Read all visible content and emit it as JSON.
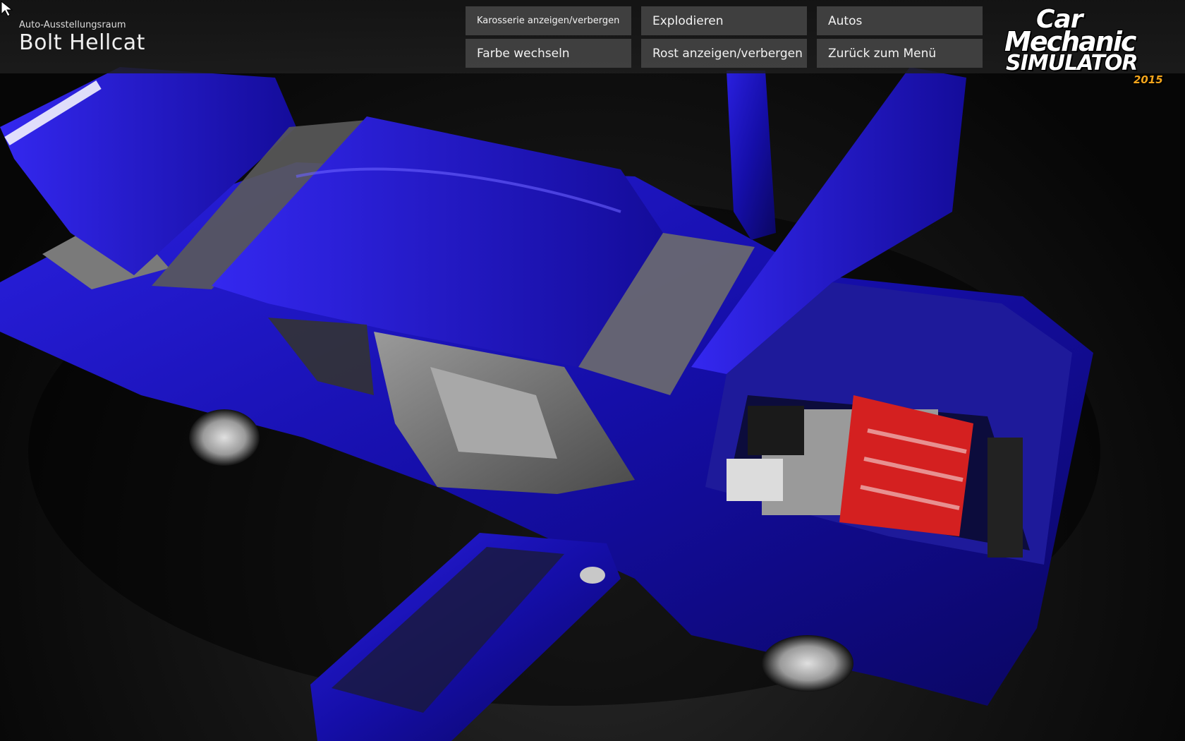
{
  "header": {
    "subtitle": "Auto-Ausstellungsraum",
    "car_name": "Bolt Hellcat"
  },
  "menu": {
    "toggle_body": "Karosserie anzeigen/verbergen",
    "explode": "Explodieren",
    "cars": "Autos",
    "change_color": "Farbe wechseln",
    "toggle_rust": "Rost anzeigen/verbergen",
    "back_to_menu": "Zurück zum Menü"
  },
  "logo": {
    "line1": "Car",
    "line2": "Mechanic",
    "line3": "SIMULATOR",
    "year": "2015"
  },
  "colors": {
    "car_paint": "#1a14c8",
    "engine_red": "#d42020",
    "logo_year": "#f3a51c"
  }
}
